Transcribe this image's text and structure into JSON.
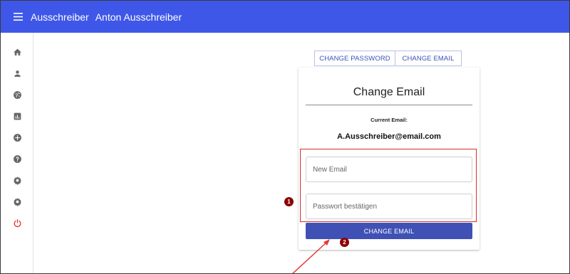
{
  "appbar": {
    "title": "Ausschreiber",
    "user": "Anton Ausschreiber"
  },
  "sidebar": {
    "items": [
      {
        "icon": "home-icon"
      },
      {
        "icon": "person-icon"
      },
      {
        "icon": "globe-icon"
      },
      {
        "icon": "bar-chart-icon"
      },
      {
        "icon": "add-circle-icon"
      },
      {
        "icon": "help-icon"
      },
      {
        "icon": "settings-icon"
      },
      {
        "icon": "settings-icon"
      },
      {
        "icon": "power-icon",
        "color": "#e53935"
      }
    ]
  },
  "tabs": {
    "change_password": "CHANGE PASSWORD",
    "change_email": "CHANGE EMAIL"
  },
  "card": {
    "title": "Change Email",
    "current_label": "Current Email:",
    "current_email": "A.Ausschreiber@email.com",
    "new_email_placeholder": "New Email",
    "new_email_value": "",
    "password_placeholder": "Passwort bestätigen",
    "password_value": "",
    "submit_label": "CHANGE EMAIL"
  },
  "annotations": {
    "marker_1": "1",
    "marker_2": "2",
    "highlight_color": "#d32f2f",
    "marker_color": "#8b0000"
  },
  "colors": {
    "appbar": "#3f57e8",
    "primary": "#3f51b5"
  }
}
